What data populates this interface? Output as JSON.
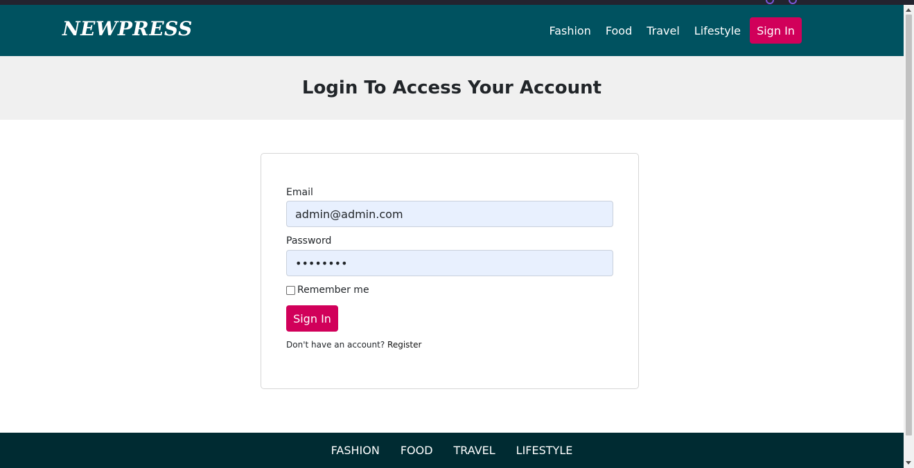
{
  "navbar": {
    "brand": "NEWPRESS",
    "links": [
      "Fashion",
      "Food",
      "Travel",
      "Lifestyle"
    ],
    "signin_label": "Sign In"
  },
  "hero": {
    "title": "Login To Access Your Account"
  },
  "form": {
    "email_label": "Email",
    "email_value": "admin@admin.com",
    "password_label": "Password",
    "password_value": "••••••••",
    "remember_label": "Remember me",
    "remember_checked": false,
    "submit_label": "Sign In",
    "register_prompt": "Don't have an account?",
    "register_link": "Register"
  },
  "footer": {
    "links": [
      "FASHION",
      "FOOD",
      "TRAVEL",
      "LIFESTYLE"
    ]
  },
  "colors": {
    "navbar_bg": "#005260",
    "accent": "#d1005a",
    "footer_bg": "#002b32",
    "hero_bg": "#f0f0f0",
    "input_bg": "#e8f0fe"
  }
}
